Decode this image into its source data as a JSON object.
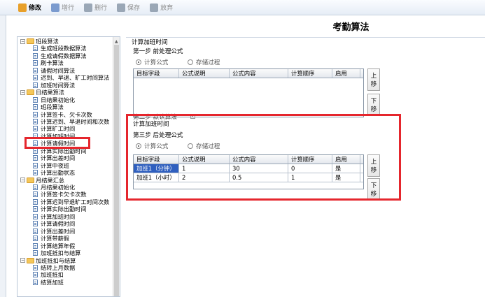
{
  "toolbar": {
    "items": [
      {
        "label": "修改",
        "icon": "pencil-icon",
        "enabled": true
      },
      {
        "label": "增行",
        "icon": "add-row-icon",
        "enabled": false
      },
      {
        "label": "删行",
        "icon": "delete-row-icon",
        "enabled": false
      },
      {
        "label": "保存",
        "icon": "save-icon",
        "enabled": false
      },
      {
        "label": "放弃",
        "icon": "discard-icon",
        "enabled": false
      }
    ]
  },
  "page_title": "考勤算法",
  "tree": {
    "items": [
      {
        "label": "班段算法",
        "type": "folder",
        "expanded": true
      },
      {
        "label": "生成班段数据算法",
        "type": "doc"
      },
      {
        "label": "生成请假数据算法",
        "type": "doc"
      },
      {
        "label": "刷卡算法",
        "type": "doc"
      },
      {
        "label": "请假时间算法",
        "type": "doc"
      },
      {
        "label": "迟到、早退、旷工时间算法",
        "type": "doc"
      },
      {
        "label": "加班时间算法",
        "type": "doc"
      },
      {
        "label": "日结果算法",
        "type": "folder",
        "expanded": true
      },
      {
        "label": "日结果初始化",
        "type": "doc"
      },
      {
        "label": "班段算法",
        "type": "doc"
      },
      {
        "label": "计算签卡、欠卡次数",
        "type": "doc"
      },
      {
        "label": "计算迟到、早退时间和次数",
        "type": "doc"
      },
      {
        "label": "计算旷工时间",
        "type": "doc"
      },
      {
        "label": "计算加班时间",
        "type": "doc",
        "selected": true
      },
      {
        "label": "计算请假时间",
        "type": "doc"
      },
      {
        "label": "计算实际出勤时间",
        "type": "doc"
      },
      {
        "label": "计算出差时间",
        "type": "doc"
      },
      {
        "label": "计算中夜班",
        "type": "doc"
      },
      {
        "label": "计算出勤状态",
        "type": "doc"
      },
      {
        "label": "月结果汇总",
        "type": "folder",
        "expanded": true
      },
      {
        "label": "月结果初始化",
        "type": "doc"
      },
      {
        "label": "计算签卡欠卡次数",
        "type": "doc"
      },
      {
        "label": "计算迟到早退旷工时间次数",
        "type": "doc"
      },
      {
        "label": "计算实际出勤时间",
        "type": "doc"
      },
      {
        "label": "计算加班时间",
        "type": "doc"
      },
      {
        "label": "计算请假时间",
        "type": "doc"
      },
      {
        "label": "计算出差时间",
        "type": "doc"
      },
      {
        "label": "计算带薪假",
        "type": "doc"
      },
      {
        "label": "计算结算年假",
        "type": "doc"
      },
      {
        "label": "加班抵扣与结算",
        "type": "doc"
      },
      {
        "label": "加班抵扣与结算",
        "type": "folder",
        "expanded": true
      },
      {
        "label": "结转上月数据",
        "type": "doc"
      },
      {
        "label": "加班抵扣",
        "type": "doc"
      },
      {
        "label": "结算加班",
        "type": "doc"
      }
    ]
  },
  "main": {
    "section_title": "计算加班时间",
    "step1": {
      "label": "第一步 前处理公式",
      "radio_formula": "计算公式",
      "radio_procedure": "存储过程"
    },
    "columns": [
      "目标字段",
      "公式说明",
      "公式内容",
      "计算顺序",
      "启用"
    ],
    "side_buttons": {
      "up": "上移",
      "down": "下移"
    },
    "step2_label": "第二步 默认算法",
    "section_title_2": "计算加班时间",
    "step3": {
      "label": "第三步 后处理公式",
      "radio_formula": "计算公式",
      "radio_procedure": "存储过程"
    },
    "rows": [
      [
        "加班1（分钟）",
        "1",
        "30",
        "0",
        "是"
      ],
      [
        "加班1（小时）",
        "2",
        "0.5",
        "1",
        "是"
      ]
    ]
  },
  "colors": {
    "highlight_border": "#e5262d",
    "selected_cell": "#2f5fbf"
  }
}
